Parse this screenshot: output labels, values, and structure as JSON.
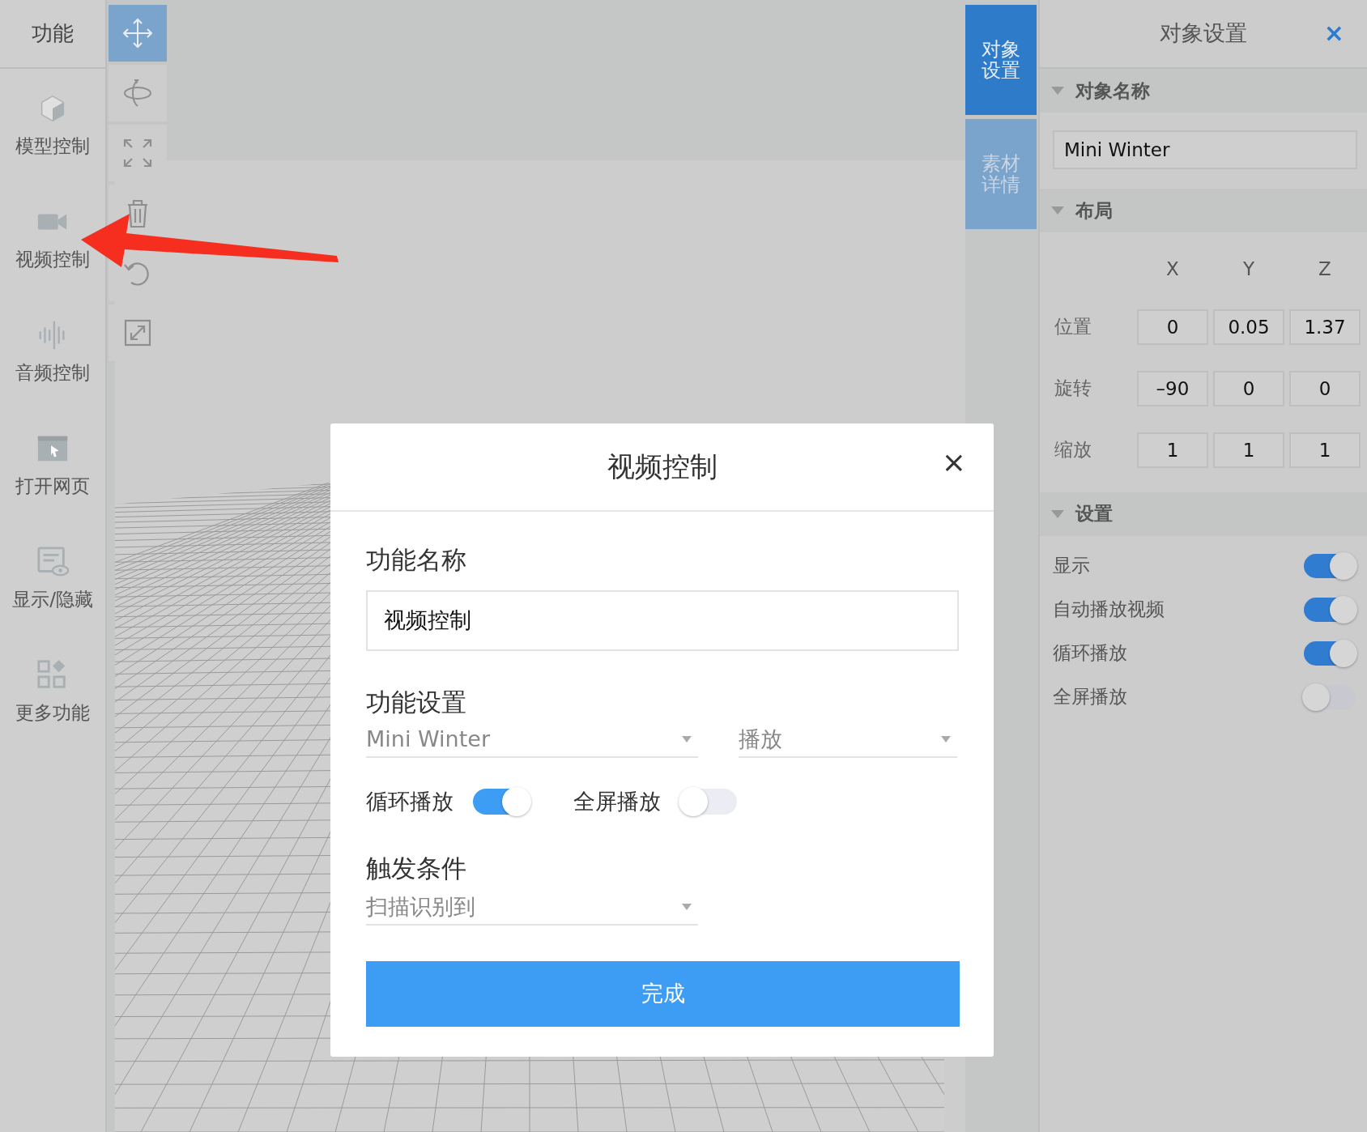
{
  "sidebar": {
    "title": "功能",
    "items": [
      {
        "label": "模型控制"
      },
      {
        "label": "视频控制"
      },
      {
        "label": "音频控制"
      },
      {
        "label": "打开网页"
      },
      {
        "label": "显示/隐藏"
      },
      {
        "label": "更多功能"
      }
    ]
  },
  "toolbar": [
    {
      "selected": true
    },
    {
      "selected": false
    },
    {
      "selected": false
    },
    {
      "selected": false
    },
    {
      "selected": false
    },
    {
      "selected": false
    }
  ],
  "side_tabs": [
    {
      "label": "对象设置",
      "selected": true
    },
    {
      "label": "素材详情",
      "selected": false
    }
  ],
  "panel": {
    "title": "对象设置",
    "close": "×",
    "name_section": {
      "title": "对象名称",
      "expanded": true,
      "value": "Mini Winter"
    },
    "layout_section": {
      "title": "布局",
      "expanded": true,
      "columns": [
        "X",
        "Y",
        "Z"
      ],
      "rows": [
        {
          "label": "位置",
          "values": [
            "0",
            "0.05",
            "1.37"
          ]
        },
        {
          "label": "旋转",
          "values": [
            "–90",
            "0",
            "0"
          ]
        },
        {
          "label": "缩放",
          "values": [
            "1",
            "1",
            "1"
          ]
        }
      ]
    },
    "settings_section": {
      "title": "设置",
      "expanded": true,
      "toggles": [
        {
          "label": "显示",
          "on": true
        },
        {
          "label": "自动播放视频",
          "on": true
        },
        {
          "label": "循环播放",
          "on": true
        },
        {
          "label": "全屏播放",
          "on": false
        }
      ]
    }
  },
  "dialog": {
    "title": "视频控制",
    "close": "×",
    "name_label": "功能名称",
    "name_value": "视频控制",
    "settings_label": "功能设置",
    "selects": [
      {
        "value": "Mini Winter"
      },
      {
        "value": "播放"
      }
    ],
    "toggles": [
      {
        "label": "循环播放",
        "on": true
      },
      {
        "label": "全屏播放",
        "on": false
      }
    ],
    "trigger_label": "触发条件",
    "trigger_value": "扫描识别到",
    "button": "完成"
  }
}
